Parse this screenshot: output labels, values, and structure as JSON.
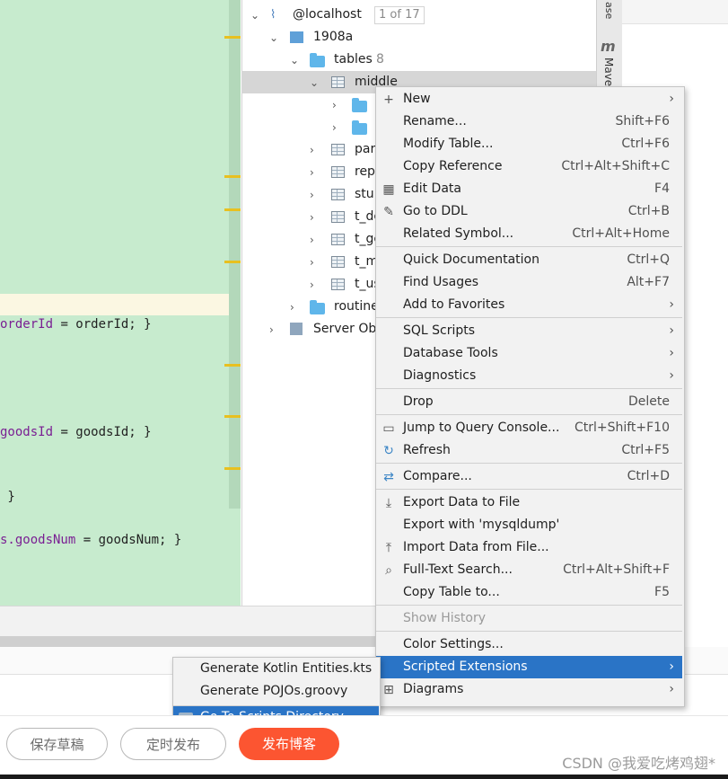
{
  "editor": {
    "code_lines": [
      {
        "prefix": "",
        "field": "orderId",
        "rest": " = orderId; }"
      },
      {
        "prefix": "",
        "field": "goodsId",
        "rest": " = goodsId; }"
      },
      {
        "prefix": "",
        "field": "",
        "rest": " }"
      },
      {
        "prefix": "s.",
        "field": "goodsNum",
        "rest": " = goodsNum; }"
      }
    ]
  },
  "tree": {
    "host": "@localhost",
    "host_count": "1 of 17",
    "database": "1908a",
    "tables_label": "tables",
    "tables_count": "8",
    "selected_table": "middle",
    "tables": [
      "par",
      "rep",
      "stu",
      "t_de",
      "t_gc",
      "t_m",
      "t_us"
    ],
    "routines": "routine",
    "server_objects": "Server Obj"
  },
  "side_tabs": {
    "database": "ase",
    "maven_icon": "m",
    "maven": "Mave"
  },
  "menu": {
    "groups": [
      [
        {
          "label": "New",
          "shortcut": "",
          "submenu": true,
          "icon": "plus-icon"
        },
        {
          "label": "Rename...",
          "shortcut": "Shift+F6",
          "submenu": false,
          "icon": ""
        },
        {
          "label": "Modify Table...",
          "shortcut": "Ctrl+F6",
          "submenu": false,
          "icon": ""
        },
        {
          "label": "Copy Reference",
          "shortcut": "Ctrl+Alt+Shift+C",
          "submenu": false,
          "icon": ""
        },
        {
          "label": "Edit Data",
          "shortcut": "F4",
          "submenu": false,
          "icon": "table-icon"
        },
        {
          "label": "Go to DDL",
          "shortcut": "Ctrl+B",
          "submenu": false,
          "icon": "pencil-icon"
        },
        {
          "label": "Related Symbol...",
          "shortcut": "Ctrl+Alt+Home",
          "submenu": false,
          "icon": ""
        }
      ],
      [
        {
          "label": "Quick Documentation",
          "shortcut": "Ctrl+Q",
          "submenu": false,
          "icon": ""
        },
        {
          "label": "Find Usages",
          "shortcut": "Alt+F7",
          "submenu": false,
          "icon": ""
        },
        {
          "label": "Add to Favorites",
          "shortcut": "",
          "submenu": true,
          "icon": ""
        }
      ],
      [
        {
          "label": "SQL Scripts",
          "shortcut": "",
          "submenu": true,
          "icon": ""
        },
        {
          "label": "Database Tools",
          "shortcut": "",
          "submenu": true,
          "icon": ""
        },
        {
          "label": "Diagnostics",
          "shortcut": "",
          "submenu": true,
          "icon": ""
        }
      ],
      [
        {
          "label": "Drop",
          "shortcut": "Delete",
          "submenu": false,
          "icon": ""
        }
      ],
      [
        {
          "label": "Jump to Query Console...",
          "shortcut": "Ctrl+Shift+F10",
          "submenu": false,
          "icon": "console-icon"
        },
        {
          "label": "Refresh",
          "shortcut": "Ctrl+F5",
          "submenu": false,
          "icon": "refresh-icon"
        }
      ],
      [
        {
          "label": "Compare...",
          "shortcut": "Ctrl+D",
          "submenu": false,
          "icon": "compare-icon"
        }
      ],
      [
        {
          "label": "Export Data to File",
          "shortcut": "",
          "submenu": false,
          "icon": "export-icon"
        },
        {
          "label": "Export with 'mysqldump'",
          "shortcut": "",
          "submenu": false,
          "icon": ""
        },
        {
          "label": "Import Data from File...",
          "shortcut": "",
          "submenu": false,
          "icon": "import-icon"
        },
        {
          "label": "Full-Text Search...",
          "shortcut": "Ctrl+Alt+Shift+F",
          "submenu": false,
          "icon": "search-icon"
        },
        {
          "label": "Copy Table to...",
          "shortcut": "F5",
          "submenu": false,
          "icon": ""
        }
      ],
      [
        {
          "label": "Show History",
          "shortcut": "",
          "submenu": false,
          "icon": "",
          "disabled": true
        }
      ],
      [
        {
          "label": "Color Settings...",
          "shortcut": "",
          "submenu": false,
          "icon": ""
        },
        {
          "label": "Scripted Extensions",
          "shortcut": "",
          "submenu": true,
          "icon": "",
          "selected": true
        },
        {
          "label": "Diagrams",
          "shortcut": "",
          "submenu": true,
          "icon": "diagram-icon"
        }
      ]
    ]
  },
  "submenu": {
    "items": [
      {
        "label": "Generate Kotlin Entities.kts"
      },
      {
        "label": "Generate POJOs.groovy"
      },
      {
        "label": "Go To Scripts Directory",
        "selected": true
      }
    ]
  },
  "publish_bar": {
    "save_draft": "保存草稿",
    "schedule": "定时发布",
    "publish": "发布博客"
  },
  "watermark": "CSDN @我爱吃烤鸡翅*"
}
